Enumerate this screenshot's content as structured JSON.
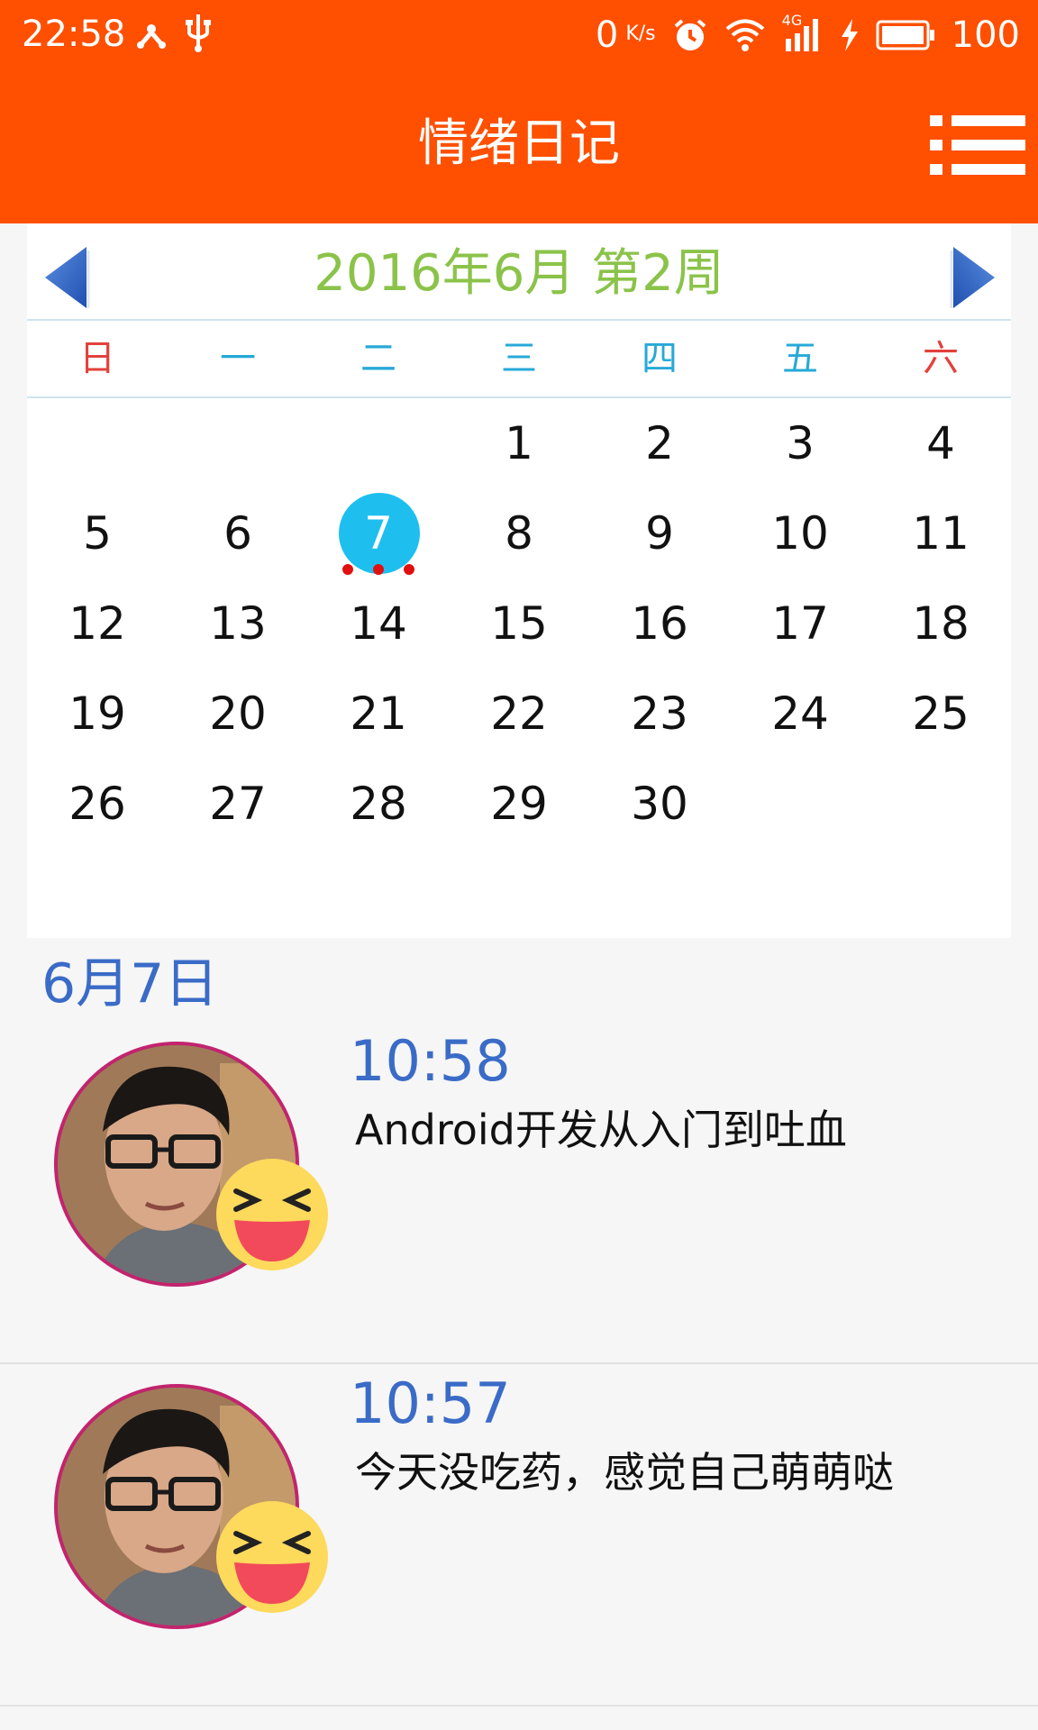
{
  "status_bar": {
    "time": "22:58",
    "speed": "0",
    "speed_unit": "K/s",
    "network": "4G",
    "battery": "100"
  },
  "app_bar": {
    "title": "情绪日记",
    "menu_icon": "list-menu-icon"
  },
  "calendar": {
    "title": "2016年6月  第2周",
    "weekdays": [
      "日",
      "一",
      "二",
      "三",
      "四",
      "五",
      "六"
    ],
    "weeks": [
      [
        "",
        "",
        "",
        "1",
        "2",
        "3",
        "4"
      ],
      [
        "5",
        "6",
        "7",
        "8",
        "9",
        "10",
        "11"
      ],
      [
        "12",
        "13",
        "14",
        "15",
        "16",
        "17",
        "18"
      ],
      [
        "19",
        "20",
        "21",
        "22",
        "23",
        "24",
        "25"
      ],
      [
        "26",
        "27",
        "28",
        "29",
        "30",
        "",
        ""
      ]
    ],
    "selected_day": "7",
    "colors": {
      "title": "#8bc34a",
      "weekday": "#27a9d8",
      "weekend": "#e2413c",
      "selected": "#1ebfef",
      "marker": "#e01010"
    }
  },
  "diary": {
    "date": "6月7日",
    "entries": [
      {
        "time": "10:58",
        "text": "Android开发从入门到吐血",
        "mood_icon": "laughing-emoji-icon"
      },
      {
        "time": "10:57",
        "text": "今天没吃药，感觉自己萌萌哒",
        "mood_icon": "laughing-emoji-icon"
      }
    ]
  },
  "theme": {
    "accent": "#ff4f00",
    "date_color": "#3a6bc7"
  }
}
